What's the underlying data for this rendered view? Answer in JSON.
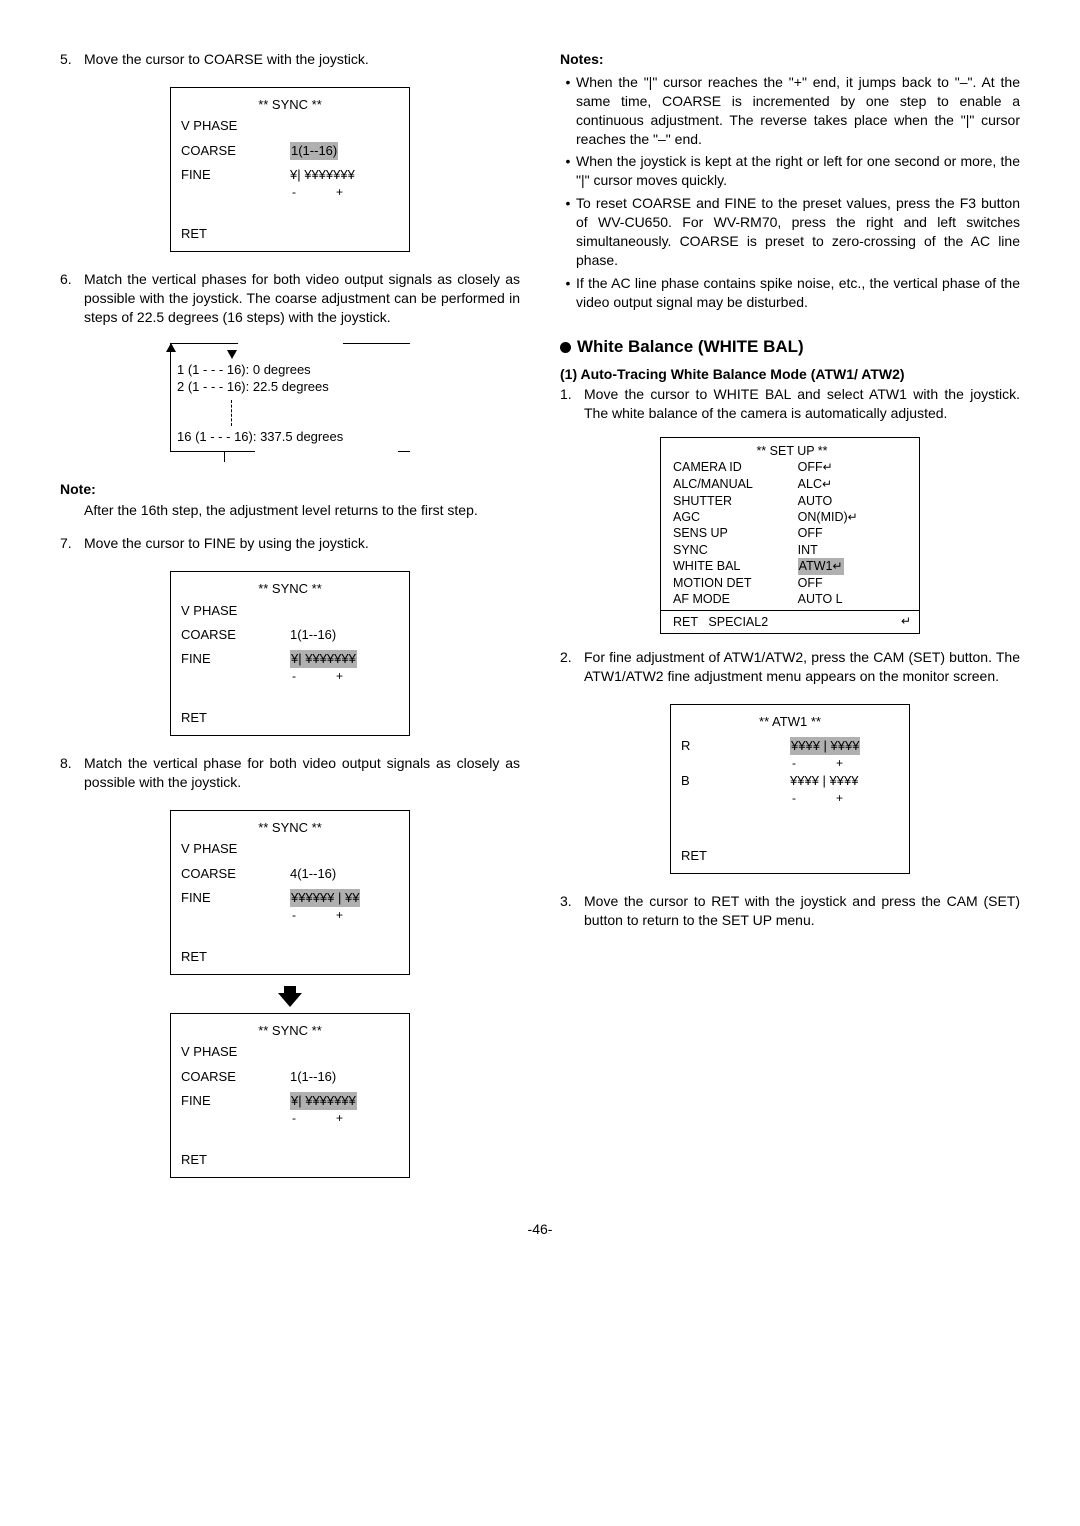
{
  "left": {
    "step5_num": "5.",
    "step5": "Move the cursor to COARSE with the joystick.",
    "step6_num": "6.",
    "step6": "Match the vertical phases for both video output signals as closely as possible with the joystick. The coarse adjustment can be performed in steps of 22.5 degrees (16 steps) with the joystick.",
    "diag_line1": "1 (1 - - - 16): 0 degrees",
    "diag_line2": "2 (1 - - - 16): 22.5 degrees",
    "diag_line3": "16 (1 - - - 16): 337.5 degrees",
    "note_hdr": "Note:",
    "note_body": "After the 16th step, the adjustment level returns to the first step.",
    "step7_num": "7.",
    "step7": "Move the cursor to FINE by using the joystick.",
    "step8_num": "8.",
    "step8": "Match the vertical phase for both video output signals as closely as possible with the joystick.",
    "sync_title": "** SYNC **",
    "vphase": "V PHASE",
    "coarse": "COARSE",
    "fine": "FINE",
    "ret": "RET",
    "coarse_v1": "1(1--16)",
    "coarse_v4": "4(1--16)",
    "fine_bar_left": "¥| ¥¥¥¥¥¥¥",
    "fine_bar_right": "¥¥¥¥¥¥ | ¥¥",
    "minus": "-",
    "plus": "+"
  },
  "right": {
    "notes_hdr": "Notes:",
    "n1": "When the \"|\" cursor reaches the \"+\" end, it jumps back to \"–\". At the same time, COARSE is incremented by one step to enable a continuous adjustment. The reverse takes place when the \"|\" cursor reaches the \"–\" end.",
    "n2": "When the joystick is kept at the right or left for one second or more, the \"|\" cursor moves quickly.",
    "n3": "To reset COARSE and FINE to the preset values, press the F3 button of WV-CU650. For WV-RM70, press the right and left switches simultaneously. COARSE is preset to zero-crossing of the AC line phase.",
    "n4": "If the AC line phase contains spike noise, etc., the vertical phase of the video output signal may be disturbed.",
    "wb_title": "White Balance (WHITE BAL)",
    "wb_sub": "(1) Auto-Tracing White Balance Mode (ATW1/ ATW2)",
    "wb_step1_num": "1.",
    "wb_step1": "Move the cursor to WHITE BAL and select ATW1 with the joystick. The white balance of the camera is automatically adjusted.",
    "setup": {
      "title": "** SET UP **",
      "r1l": "CAMERA ID",
      "r1v": "OFF",
      "r2l": "ALC/MANUAL",
      "r2v": "ALC",
      "r3l": "SHUTTER",
      "r3v": "AUTO",
      "r4l": "AGC",
      "r4v": "ON(MID)",
      "r5l": "SENS UP",
      "r5v": "OFF",
      "r6l": "SYNC",
      "r6v": "INT",
      "r7l": "WHITE BAL",
      "r7v": "ATW1",
      "r8l": "MOTION DET",
      "r8v": "OFF",
      "r9l": "AF MODE",
      "r9v": "AUTO L",
      "fl": "RET",
      "fm": "SPECIAL2",
      "fr": ""
    },
    "wb_step2_num": "2.",
    "wb_step2": "For fine adjustment of ATW1/ATW2, press the CAM (SET) button. The ATW1/ATW2 fine adjustment menu appears on the monitor screen.",
    "atw_title": "** ATW1 **",
    "atw_r": "R",
    "atw_b": "B",
    "atw_bar": "¥¥¥¥ | ¥¥¥¥",
    "atw_ret": "RET",
    "wb_step3_num": "3.",
    "wb_step3": "Move the cursor to RET with the joystick and press the CAM (SET) button to return to the SET UP menu."
  },
  "page": "-46-"
}
